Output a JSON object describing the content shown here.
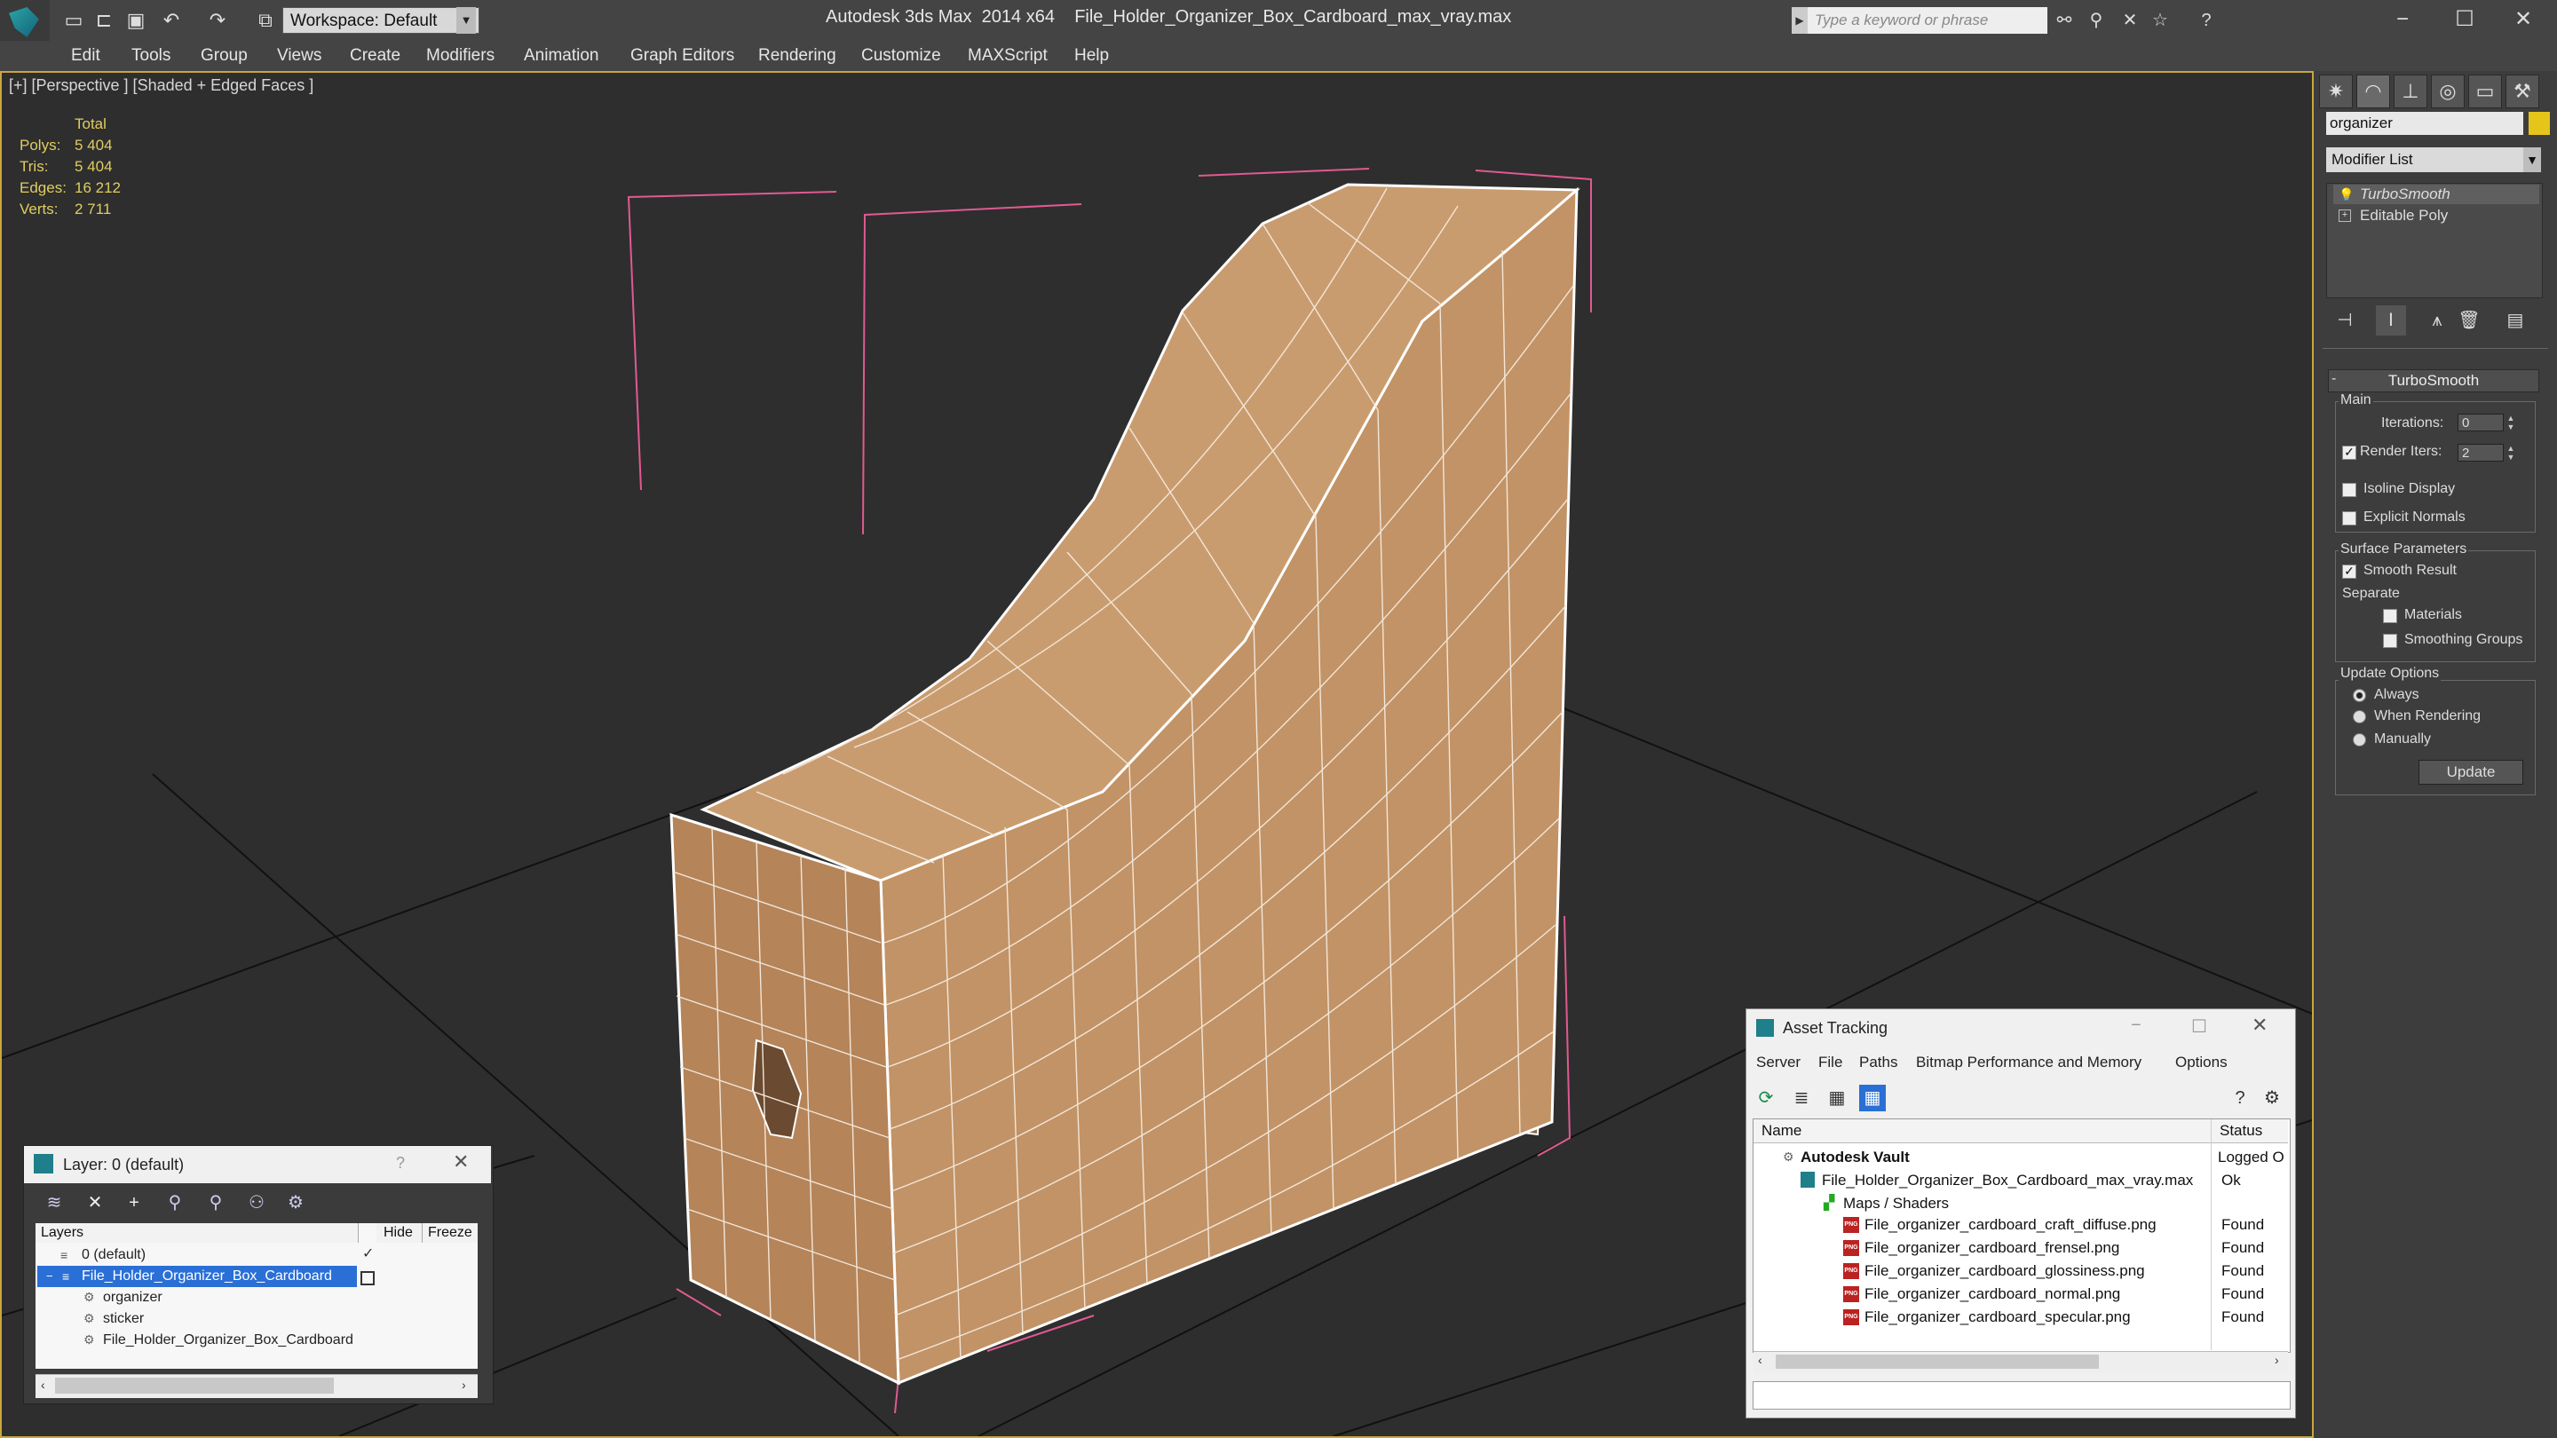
{
  "titlebar": {
    "workspace": "Workspace: Default",
    "app_title": "Autodesk 3ds Max  2014 x64",
    "file_title": "File_Holder_Organizer_Box_Cardboard_max_vray.max",
    "search_placeholder": "Type a keyword or phrase"
  },
  "menu": [
    "Edit",
    "Tools",
    "Group",
    "Views",
    "Create",
    "Modifiers",
    "Animation",
    "Graph Editors",
    "Rendering",
    "Customize",
    "MAXScript",
    "Help"
  ],
  "viewport": {
    "label": "[+] [Perspective ] [Shaded + Edged Faces ]",
    "stats_header": "Total",
    "stats": [
      {
        "label": "Polys:",
        "value": "5 404"
      },
      {
        "label": "Tris:",
        "value": "5 404"
      },
      {
        "label": "Edges:",
        "value": "16 212"
      },
      {
        "label": "Verts:",
        "value": "2 711"
      }
    ]
  },
  "command_panel": {
    "object_name": "organizer",
    "object_color": "#e5c51a",
    "modifier_list": "Modifier List",
    "stack": [
      "TurboSmooth",
      "Editable Poly"
    ],
    "rollout_title": "TurboSmooth",
    "main_group": "Main",
    "iterations_label": "Iterations:",
    "iterations_value": "0",
    "render_iters_label": "Render Iters:",
    "render_iters_value": "2",
    "render_iters_checked": true,
    "isoline_label": "Isoline Display",
    "explicit_normals_label": "Explicit Normals",
    "surface_group": "Surface Parameters",
    "smooth_result_label": "Smooth Result",
    "separate_label": "Separate",
    "materials_label": "Materials",
    "smoothing_groups_label": "Smoothing Groups",
    "update_group": "Update Options",
    "update_options": [
      "Always",
      "When Rendering",
      "Manually"
    ],
    "update_selected": "Always",
    "update_button": "Update"
  },
  "layer_dialog": {
    "title": "Layer: 0 (default)",
    "help": "?",
    "columns": [
      "Layers",
      "Hide",
      "Freeze"
    ],
    "rows": [
      "0 (default)",
      "File_Holder_Organizer_Box_Cardboard",
      "organizer",
      "sticker",
      "File_Holder_Organizer_Box_Cardboard"
    ]
  },
  "asset_dialog": {
    "title": "Asset Tracking",
    "menu": [
      "Server",
      "File",
      "Paths",
      "Bitmap Performance and Memory",
      "Options"
    ],
    "columns": [
      "Name",
      "Status"
    ],
    "rows": [
      {
        "name": "Autodesk Vault",
        "status": "Logged O"
      },
      {
        "name": "File_Holder_Organizer_Box_Cardboard_max_vray.max",
        "status": "Ok"
      },
      {
        "name": "Maps / Shaders",
        "status": ""
      },
      {
        "name": "File_organizer_cardboard_craft_diffuse.png",
        "status": "Found"
      },
      {
        "name": "File_organizer_cardboard_frensel.png",
        "status": "Found"
      },
      {
        "name": "File_organizer_cardboard_glossiness.png",
        "status": "Found"
      },
      {
        "name": "File_organizer_cardboard_normal.png",
        "status": "Found"
      },
      {
        "name": "File_organizer_cardboard_specular.png",
        "status": "Found"
      }
    ],
    "png_badge": "PNG"
  }
}
